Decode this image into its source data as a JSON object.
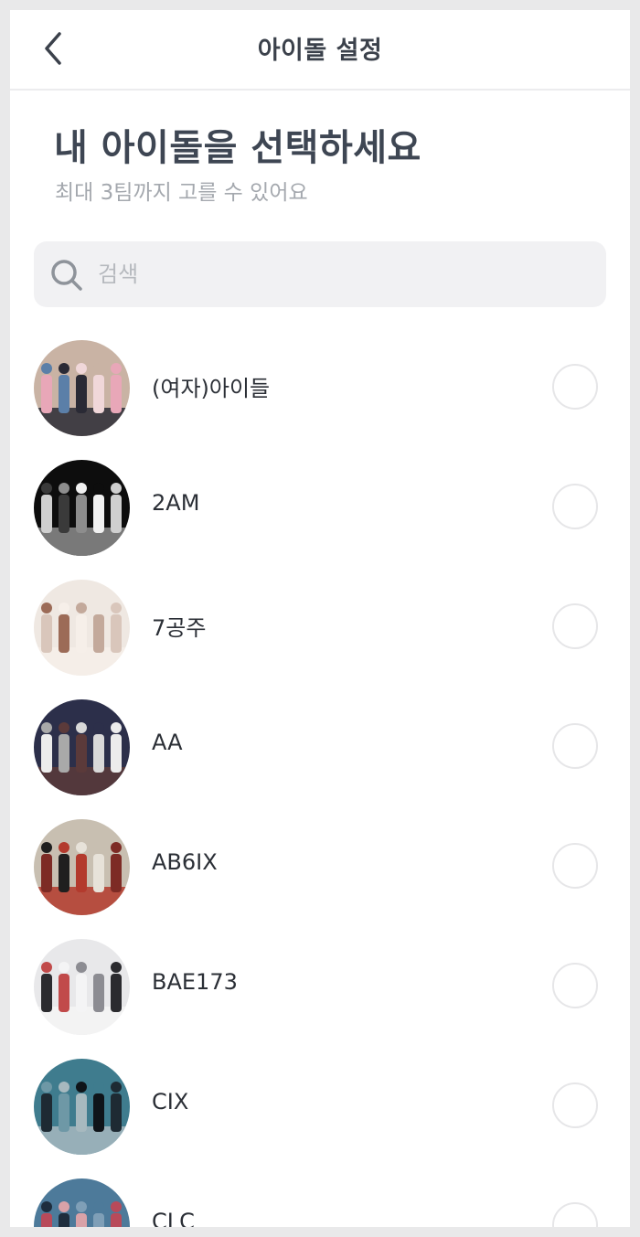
{
  "nav": {
    "title": "아이돌 설정",
    "back_icon": "chevron-left-icon"
  },
  "header": {
    "title": "내 아이돌을 선택하세요",
    "subtitle": "최대 3팀까지 고를 수 있어요"
  },
  "search": {
    "placeholder": "검색",
    "value": "",
    "icon": "search-icon"
  },
  "idols": [
    {
      "name": "(여자)아이들",
      "selected": false,
      "palette": [
        "#c9b3a4",
        "#e8a7b8",
        "#5b7fa8",
        "#2a2a35",
        "#f0d7d9"
      ]
    },
    {
      "name": "2AM",
      "selected": false,
      "palette": [
        "#0d0d0d",
        "#cfcfcf",
        "#3a3a3a",
        "#8d8d8d",
        "#f1f1f1"
      ]
    },
    {
      "name": "7공주",
      "selected": false,
      "palette": [
        "#efe8e2",
        "#d9c6bb",
        "#9c6b57",
        "#f6efe9",
        "#c3a99b"
      ]
    },
    {
      "name": "AA",
      "selected": false,
      "palette": [
        "#2c2f4a",
        "#ececec",
        "#a9a9a9",
        "#5b3a3a",
        "#d9d9d9"
      ]
    },
    {
      "name": "AB6IX",
      "selected": false,
      "palette": [
        "#c8bfb1",
        "#7d2b25",
        "#1f1f1f",
        "#b33a2d",
        "#e7e2d9"
      ]
    },
    {
      "name": "BAE173",
      "selected": false,
      "palette": [
        "#e8e8ea",
        "#2b2b2f",
        "#c14a4a",
        "#f4f4f5",
        "#8c8c92"
      ]
    },
    {
      "name": "CIX",
      "selected": false,
      "palette": [
        "#3f7c8e",
        "#1e2a33",
        "#6e98a6",
        "#a7b9bf",
        "#0f1419"
      ]
    },
    {
      "name": "CLC",
      "selected": false,
      "palette": [
        "#4d7a9a",
        "#b84a5a",
        "#1e2d3d",
        "#d9a2a8",
        "#7f9fb7"
      ]
    }
  ]
}
